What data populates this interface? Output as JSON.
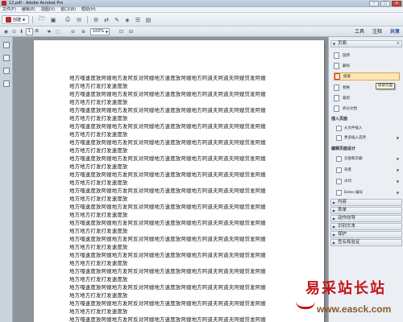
{
  "window": {
    "title": "12.pdf - Adobe Acrobat Pro"
  },
  "menubar": [
    "文件(F)",
    "编辑(E)",
    "视图(V)",
    "窗口(W)",
    "帮助(H)"
  ],
  "toolbar": {
    "create_label": "创建"
  },
  "navigation": {
    "current_page": "1",
    "total_pages": "/6",
    "zoom": "100%"
  },
  "right_tabs": [
    "工具",
    "注释",
    "共享"
  ],
  "document": {
    "lines": [
      "地方嘎速度放阿嫂地方发阿反对阿嫂地方速度放阿嫂地方阿道夫阿道夫阿嫂贷发阿嫂",
      "地方地方打发打发速度放",
      "地方嘎速度放阿嫂地方发阿反对阿嫂地方速度放阿嫂地方阿道夫阿道夫阿嫂贷发阿嫂",
      "地方地方打发打发速度放",
      "地方嘎速度放阿嫂地方发阿反对阿嫂地方速度放阿嫂地方阿道夫阿道夫阿嫂贷发阿嫂",
      "地方地方打发打发速度放",
      "地方嘎速度放阿嫂地方发阿反对阿嫂地方速度放阿嫂地方阿道夫阿道夫阿嫂贷发阿嫂",
      "地方地方打发打发速度放",
      "地方嘎速度放阿嫂地方发阿反对阿嫂地方速度放阿嫂地方阿道夫阿道夫阿嫂贷发阿嫂",
      "地方地方打发打发速度放",
      "地方嘎速度放阿嫂地方发阿反对阿嫂地方速度放阿嫂地方阿道夫阿道夫阿嫂贷发阿嫂",
      "地方地方打发打发速度放",
      "地方嘎速度放阿嫂地方发阿反对阿嫂地方速度放阿嫂地方阿道夫阿道夫阿嫂贷发阿嫂",
      "地方地方打发打发速度放",
      "地方嘎速度放阿嫂地方发阿反对阿嫂地方速度放阿嫂地方阿道夫阿道夫阿嫂贷发阿嫂",
      "地方地方打发打发速度放",
      "地方嘎速度放阿嫂地方发阿反对阿嫂地方速度放阿嫂地方阿道夫阿道夫阿嫂贷发阿嫂",
      "地方地方打发打发速度放",
      "地方嘎速度放阿嫂地方发阿反对阿嫂地方速度放阿嫂地方阿道夫阿道夫阿嫂贷发阿嫂",
      "地方地方打发打发速度放",
      "地方嘎速度放阿嫂地方发阿反对阿嫂地方速度放阿嫂地方阿道夫阿道夫阿嫂贷发阿嫂",
      "地方地方打发打发速度放",
      "地方嘎速度放阿嫂地方发阿反对阿嫂地方速度放阿嫂地方阿道夫阿道夫阿嫂贷发阿嫂",
      "地方地方打发打发速度放",
      "地方嘎速度放阿嫂地方发阿反对阿嫂地方速度放阿嫂地方阿道夫阿道夫阿嫂贷发阿嫂",
      "地方地方打发打发速度放",
      "地方嘎速度放阿嫂地方发阿反对阿嫂地方速度放阿嫂地方阿道夫阿道夫阿嫂贷发阿嫂",
      "地方地方打发打发速度放",
      "地方嘎速度放阿嫂地方发阿反对阿嫂地方速度放阿嫂地方阿道夫阿道夫阿嫂贷发阿嫂",
      "地方地方打发打发速度放",
      "地方嘎速度放阿嫂地方发阿反对阿嫂地方速度放阿嫂地方阿道夫阿道夫阿嫂贷发阿嫂"
    ]
  },
  "tools_panel": {
    "pages_section": {
      "header": "页面",
      "items": [
        "旋转",
        "删除",
        "提取",
        "替换",
        "裁剪",
        "拆分文档"
      ],
      "tooltip": "提取页面"
    },
    "insert_section": {
      "header": "插入页面",
      "items": [
        "从文件插入",
        "更多插入选项"
      ]
    },
    "design_section": {
      "header": "编辑页面设计",
      "items": [
        "页眉和页脚",
        "背景",
        "水印",
        "Bates 编号"
      ]
    },
    "collapsed_sections": [
      "内容",
      "表单",
      "动作向导",
      "识别文本",
      "保护",
      "签名和验证"
    ]
  },
  "watermark": {
    "main": "易采站长站",
    "url": "www.easck.com"
  }
}
